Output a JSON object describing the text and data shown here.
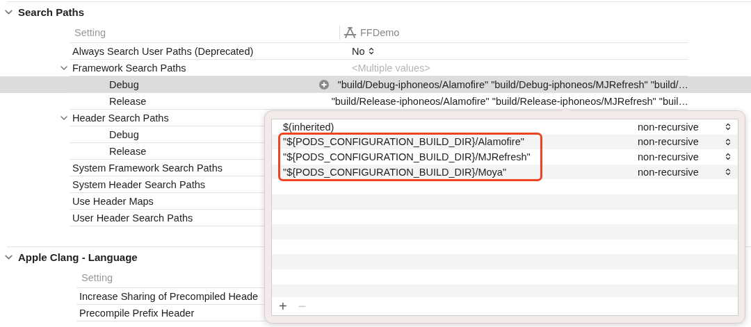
{
  "sections": [
    {
      "title": "Search Paths",
      "expanded": true,
      "header": {
        "setting": "Setting",
        "target": "FFDemo"
      },
      "rows": [
        {
          "label": "Always Search User Paths (Deprecated)",
          "selected": false,
          "value": "No",
          "kind": "popup"
        },
        {
          "label": "Framework Search Paths",
          "selected": false,
          "expanded": true,
          "value": "<Multiple values>",
          "kind": "multiple",
          "children": [
            {
              "label": "Debug",
              "selected": true,
              "value": "\"build/Debug-iphoneos/Alamofire\" \"build/Debug-iphoneos/MJRefresh\" \"build/…",
              "kind": "text"
            },
            {
              "label": "Release",
              "selected": false,
              "value": "\"build/Release-iphoneos/Alamofire\" \"build/Release-iphoneos/MJRefresh\" \"buil…",
              "kind": "text"
            }
          ]
        },
        {
          "label": "Header Search Paths",
          "selected": false,
          "expanded": true,
          "children": [
            {
              "label": "Debug",
              "selected": false
            },
            {
              "label": "Release",
              "selected": false
            }
          ]
        },
        {
          "label": "System Framework Search Paths",
          "selected": false
        },
        {
          "label": "System Header Search Paths",
          "selected": false
        },
        {
          "label": "Use Header Maps",
          "selected": false
        },
        {
          "label": "User Header Search Paths",
          "selected": false
        }
      ]
    },
    {
      "title": "Apple Clang - Language",
      "expanded": true,
      "header": {
        "setting": "Setting"
      },
      "rows": [
        {
          "label": "Increase Sharing of Precompiled Heade",
          "selected": false
        },
        {
          "label": "Precompile Prefix Header",
          "selected": false
        }
      ]
    }
  ],
  "popover": {
    "entries": [
      {
        "path": "$(inherited)",
        "recursion": "non-recursive",
        "marked": false
      },
      {
        "path": "\"${PODS_CONFIGURATION_BUILD_DIR}/Alamofire\"",
        "recursion": "non-recursive",
        "marked": true
      },
      {
        "path": "\"${PODS_CONFIGURATION_BUILD_DIR}/MJRefresh\"",
        "recursion": "non-recursive",
        "marked": true
      },
      {
        "path": "\"${PODS_CONFIGURATION_BUILD_DIR}/Moya\"",
        "recursion": "non-recursive",
        "marked": true
      }
    ],
    "buttons": [
      {
        "label": "+",
        "disabled": false
      },
      {
        "label": "−",
        "disabled": true
      }
    ]
  }
}
